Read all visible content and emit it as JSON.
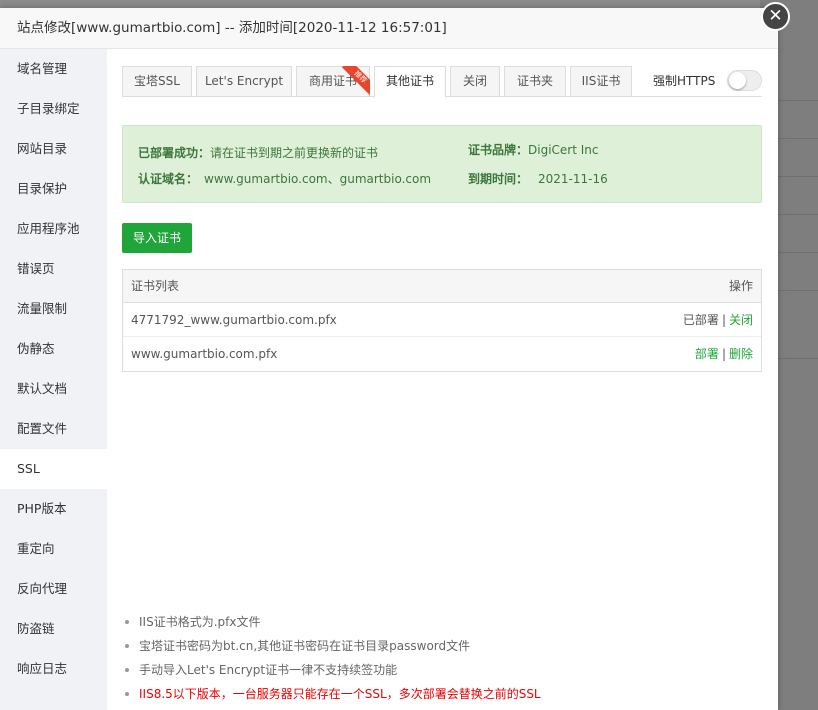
{
  "dialog": {
    "title": "站点修改[www.gumartbio.com] -- 添加时间[2020-11-12 16:57:01]",
    "close_icon": "close-icon"
  },
  "sidebar": {
    "items": [
      {
        "label": "域名管理"
      },
      {
        "label": "子目录绑定"
      },
      {
        "label": "网站目录"
      },
      {
        "label": "目录保护"
      },
      {
        "label": "应用程序池"
      },
      {
        "label": "错误页"
      },
      {
        "label": "流量限制"
      },
      {
        "label": "伪静态"
      },
      {
        "label": "默认文档"
      },
      {
        "label": "配置文件"
      },
      {
        "label": "SSL",
        "active": true
      },
      {
        "label": "PHP版本"
      },
      {
        "label": "重定向"
      },
      {
        "label": "反向代理"
      },
      {
        "label": "防盗链"
      },
      {
        "label": "响应日志"
      }
    ]
  },
  "tabs": [
    {
      "label": "宝塔SSL"
    },
    {
      "label": "Let's Encrypt"
    },
    {
      "label": "商用证书",
      "ribbon": "推荐"
    },
    {
      "label": "其他证书",
      "active": true
    },
    {
      "label": "关闭"
    },
    {
      "label": "证书夹"
    },
    {
      "label": "IIS证书"
    }
  ],
  "force_https": {
    "label": "强制HTTPS",
    "enabled": false
  },
  "status": {
    "deploy_label": "已部署成功：",
    "deploy_text": "请在证书到期之前更换新的证书",
    "domain_label": "认证域名：",
    "domain_value": "www.gumartbio.com、gumartbio.com",
    "brand_label": "证书品牌：",
    "brand_value": "DigiCert Inc",
    "expire_label": "到期时间：",
    "expire_value": "2021-11-16"
  },
  "import_button": "导入证书",
  "cert_table": {
    "header_name": "证书列表",
    "header_op": "操作",
    "rows": [
      {
        "name": "4771792_www.gumartbio.com.pfx",
        "action1": "已部署",
        "sep": "|",
        "action2": "关闭"
      },
      {
        "name": "www.gumartbio.com.pfx",
        "action1": "部署",
        "sep": "|",
        "action2": "删除"
      }
    ]
  },
  "tips": [
    "IIS证书格式为.pfx文件",
    "宝塔证书密码为bt.cn,其他证书密码在证书目录password文件",
    "手动导入Let's Encrypt证书一律不支持续签功能",
    "IIS8.5以下版本，一台服务器只能存在一个SSL，多次部署会替换之前的SSL"
  ],
  "colors": {
    "accent": "#20a53a",
    "alert_bg": "#dff0d8",
    "alert_text": "#3c763d",
    "warning": "#ee0000"
  }
}
